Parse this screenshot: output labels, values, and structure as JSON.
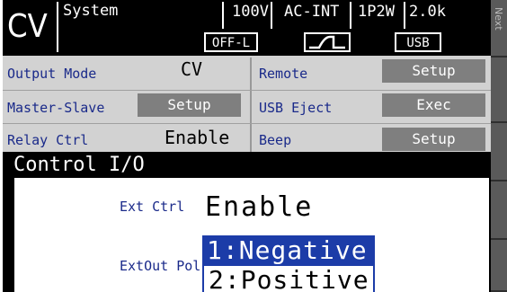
{
  "header": {
    "mode": "CV",
    "menu_title": "System",
    "voltage": "100V",
    "source": "AC-INT",
    "phase": "1P2W",
    "power": "2.0k",
    "off_level": "OFF-L",
    "usb_badge": "USB",
    "waveform_icon": "step-waveform-icon"
  },
  "side_tab": {
    "label": "Next"
  },
  "settings": {
    "left": [
      {
        "label": "Output Mode",
        "value": "CV"
      },
      {
        "label": "Master-Slave",
        "button": "Setup"
      },
      {
        "label": "Relay Ctrl",
        "value": "Enable"
      }
    ],
    "right": [
      {
        "label": "Remote",
        "button": "Setup"
      },
      {
        "label": "USB Eject",
        "button": "Exec"
      },
      {
        "label": "Beep",
        "button": "Setup"
      }
    ]
  },
  "dialog": {
    "title": "Control I/O",
    "ext_ctrl_label": "Ext Ctrl",
    "ext_ctrl_value": "Enable",
    "extout_label": "ExtOut Pol",
    "options": [
      "1:Negative",
      "2:Positive"
    ],
    "selected_option": "1:Negative"
  },
  "colors": {
    "label_blue": "#1a2a8a",
    "selection_blue": "#1c3ca8",
    "button_gray": "#7f7f7f",
    "panel_gray": "#d2d2d2"
  }
}
